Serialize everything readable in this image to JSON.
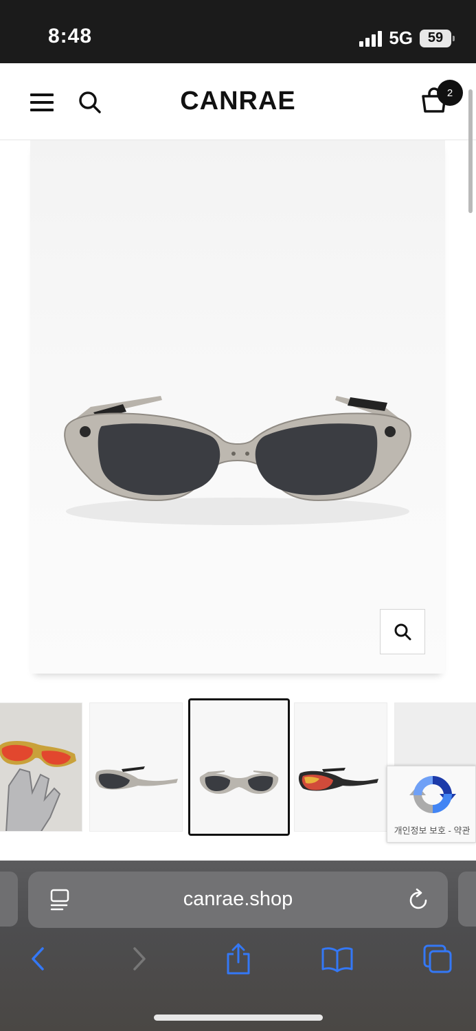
{
  "status_bar": {
    "time": "8:48",
    "network": "5G",
    "battery": "59"
  },
  "header": {
    "logo": "CANRAE",
    "cart_count": "2"
  },
  "product": {
    "main_image": "silver-frame-dark-lens-sunglasses",
    "zoom_icon": "magnifier-icon"
  },
  "thumbnails": [
    {
      "image": "red-lens-sunglasses-on-robot-hand",
      "selected": false
    },
    {
      "image": "silver-sunglasses-side-view",
      "selected": false
    },
    {
      "image": "silver-sunglasses-front-view",
      "selected": true
    },
    {
      "image": "red-lens-sunglasses-side-view",
      "selected": false
    },
    {
      "image": "sunglasses-partial-view",
      "selected": false
    }
  ],
  "recaptcha": {
    "text": "개인정보 보호 - 약관"
  },
  "browser": {
    "url": "canrae.shop",
    "icons": [
      "back-icon",
      "forward-icon",
      "share-icon",
      "bookmarks-icon",
      "tabs-icon"
    ]
  },
  "colors": {
    "accent": "#3478f6",
    "header_bg": "#1b1b1b",
    "badge": "#111111"
  }
}
